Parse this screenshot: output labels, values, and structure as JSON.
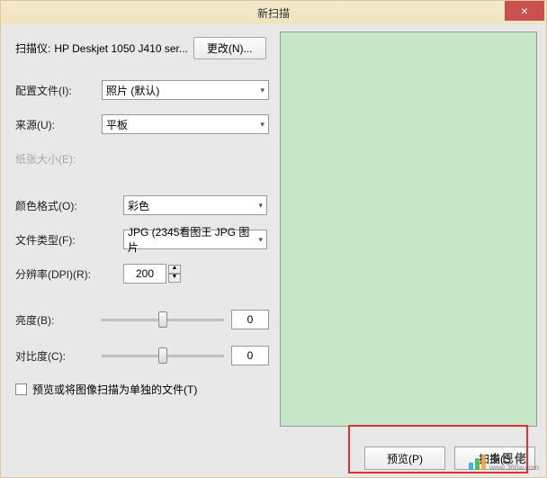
{
  "title": "新扫描",
  "close_label": "×",
  "scanner": {
    "label": "扫描仪:",
    "name": "HP Deskjet 1050 J410 ser...",
    "change_btn": "更改(N)..."
  },
  "profile": {
    "label": "配置文件(I):",
    "value": "照片 (默认)"
  },
  "source": {
    "label": "来源(U):",
    "value": "平板"
  },
  "paper_size": {
    "label": "纸张大小(E):"
  },
  "color_format": {
    "label": "颜色格式(O):",
    "value": "彩色"
  },
  "file_type": {
    "label": "文件类型(F):",
    "value": "JPG (2345看图王 JPG 图片"
  },
  "resolution": {
    "label": "分辨率(DPI)(R):",
    "value": "200"
  },
  "brightness": {
    "label": "亮度(B):",
    "value": "0"
  },
  "contrast": {
    "label": "对比度(C):",
    "value": "0"
  },
  "separate_files_label": "预览或将图像扫描为单独的文件(T)",
  "footer": {
    "preview": "预览(P)",
    "scan": "扫描(S"
  },
  "watermark": {
    "cn": "乡巴佬",
    "url": "www.386w.com"
  }
}
